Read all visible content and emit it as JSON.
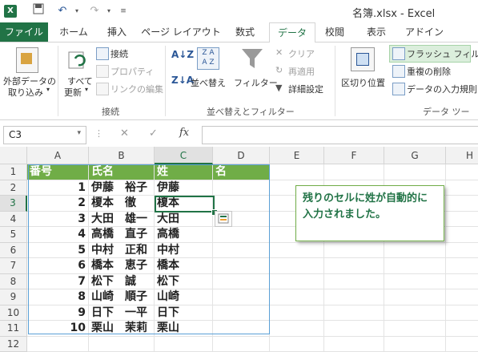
{
  "title": "名簿.xlsx - Excel",
  "tabs": [
    "ファイル",
    "ホーム",
    "挿入",
    "ページ レイアウト",
    "数式",
    "データ",
    "校閲",
    "表示",
    "アドイン"
  ],
  "ribbon": {
    "external_data": "外部データの",
    "external_data2": "取り込み",
    "refresh_all": "すべて",
    "refresh_all2": "更新",
    "connections": "接続",
    "properties": "プロパティ",
    "edit_links": "リンクの編集",
    "group_connections": "接続",
    "sort": "並べ替え",
    "filter": "フィルター",
    "clear": "クリア",
    "reapply": "再適用",
    "advanced": "詳細設定",
    "group_sort_filter": "並べ替えとフィルター",
    "text_to_columns": "区切り位置",
    "flash_fill": "フラッシュ フィル",
    "remove_duplicates": "重複の削除",
    "data_validation": "データの入力規則",
    "group_data_tools": "データ ツー"
  },
  "formula_bar": {
    "name_box": "C3",
    "fx": "fx",
    "formula": ""
  },
  "columns": [
    "A",
    "B",
    "C",
    "D",
    "E",
    "F",
    "G",
    "H"
  ],
  "rows": [
    "1",
    "2",
    "3",
    "4",
    "5",
    "6",
    "7",
    "8",
    "9",
    "10",
    "11",
    "12"
  ],
  "table": {
    "headers": [
      "番号",
      "氏名",
      "姓",
      "名"
    ],
    "data": [
      [
        "1",
        "伊藤　裕子",
        "伊藤"
      ],
      [
        "2",
        "榎本　徹",
        "榎本"
      ],
      [
        "3",
        "大田　雄一",
        "大田"
      ],
      [
        "4",
        "高橋　直子",
        "高橋"
      ],
      [
        "5",
        "中村　正和",
        "中村"
      ],
      [
        "6",
        "橋本　恵子",
        "橋本"
      ],
      [
        "7",
        "松下　誠",
        "松下"
      ],
      [
        "8",
        "山崎　順子",
        "山崎"
      ],
      [
        "9",
        "日下　一平",
        "日下"
      ],
      [
        "10",
        "栗山　茉莉",
        "栗山"
      ]
    ]
  },
  "callout": "残りのセルに姓が自動的に入力されました。",
  "colors": {
    "excel_green": "#217346",
    "header_fill": "#70ad47"
  }
}
